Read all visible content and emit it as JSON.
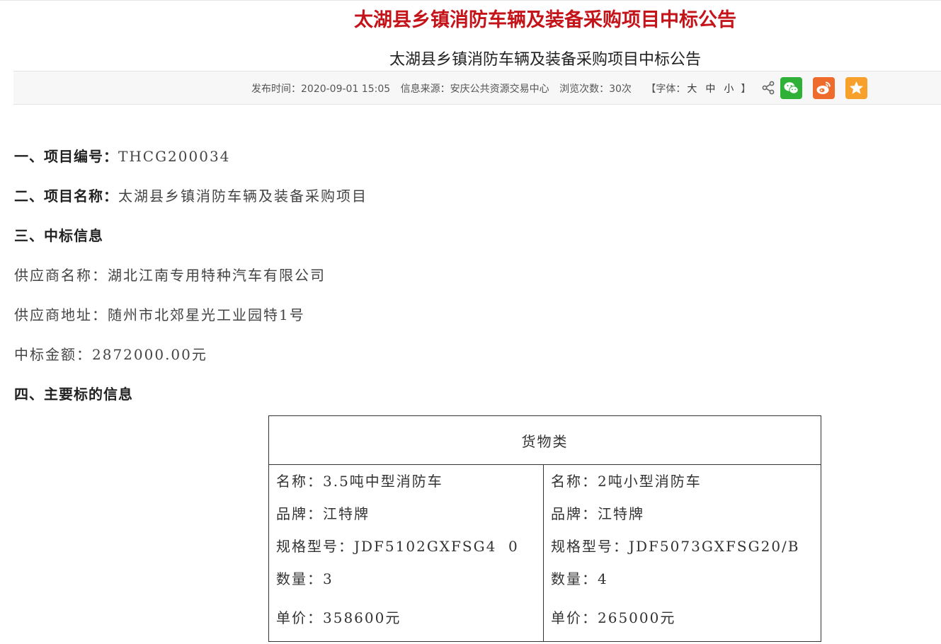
{
  "header": {
    "red_title": "太湖县乡镇消防车辆及装备采购项目中标公告",
    "sub_title": "太湖县乡镇消防车辆及装备采购项目中标公告"
  },
  "meta": {
    "publish_time": "发布时间：2020-09-01 15:05",
    "source": "信息来源：安庆公共资源交易中心",
    "views": "浏览次数：30次",
    "font_prefix": "【字体：",
    "font_large": "大",
    "font_medium": "中",
    "font_small": "小",
    "font_suffix": "】",
    "colors": {
      "wechat": "#2fb137",
      "weibo": "#ee6b2b",
      "favorite": "#f7a02b"
    }
  },
  "body": {
    "project_no_label": "一、项目编号：",
    "project_no_value": "THCG200034",
    "project_name_label": "二、项目名称：",
    "project_name_value": "太湖县乡镇消防车辆及装备采购项目",
    "award_info_label": "三、中标信息",
    "supplier_name": "供应商名称：湖北江南专用特种汽车有限公司",
    "supplier_address": "供应商地址：随州市北郊星光工业园特1号",
    "award_amount": "中标金额：2872000.00元",
    "main_items_label": "四、主要标的信息"
  },
  "goods_table": {
    "header": "货物类",
    "items": [
      {
        "name": "名称：3.5吨中型消防车",
        "brand": "品牌：江特牌",
        "model": "规格型号：JDF5102GXFSG4  0",
        "quantity": "数量：3",
        "unit_price": "单价：358600元"
      },
      {
        "name": "名称：2吨小型消防车",
        "brand": "品牌：江特牌",
        "model": "规格型号：JDF5073GXFSG20/B",
        "quantity": "数量：4",
        "unit_price": "单价：265000元"
      }
    ]
  }
}
